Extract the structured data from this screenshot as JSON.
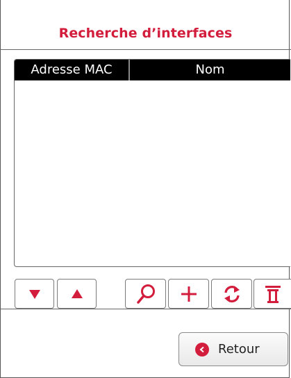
{
  "dialog": {
    "title": "Recherche d’interfaces"
  },
  "table": {
    "columns": [
      {
        "label": "Adresse MAC"
      },
      {
        "label": "Nom"
      }
    ],
    "rows": []
  },
  "toolbar": {
    "buttons": [
      {
        "icon": "arrow-down-icon"
      },
      {
        "icon": "arrow-up-icon"
      },
      {
        "icon": "search-icon"
      },
      {
        "icon": "plus-icon"
      },
      {
        "icon": "refresh-icon"
      },
      {
        "icon": "trash-icon"
      }
    ]
  },
  "footer": {
    "back_label": "Retour",
    "back_icon": "chevron-left-icon"
  },
  "colors": {
    "accent": "#d31d3c",
    "header_bg": "#000000"
  }
}
